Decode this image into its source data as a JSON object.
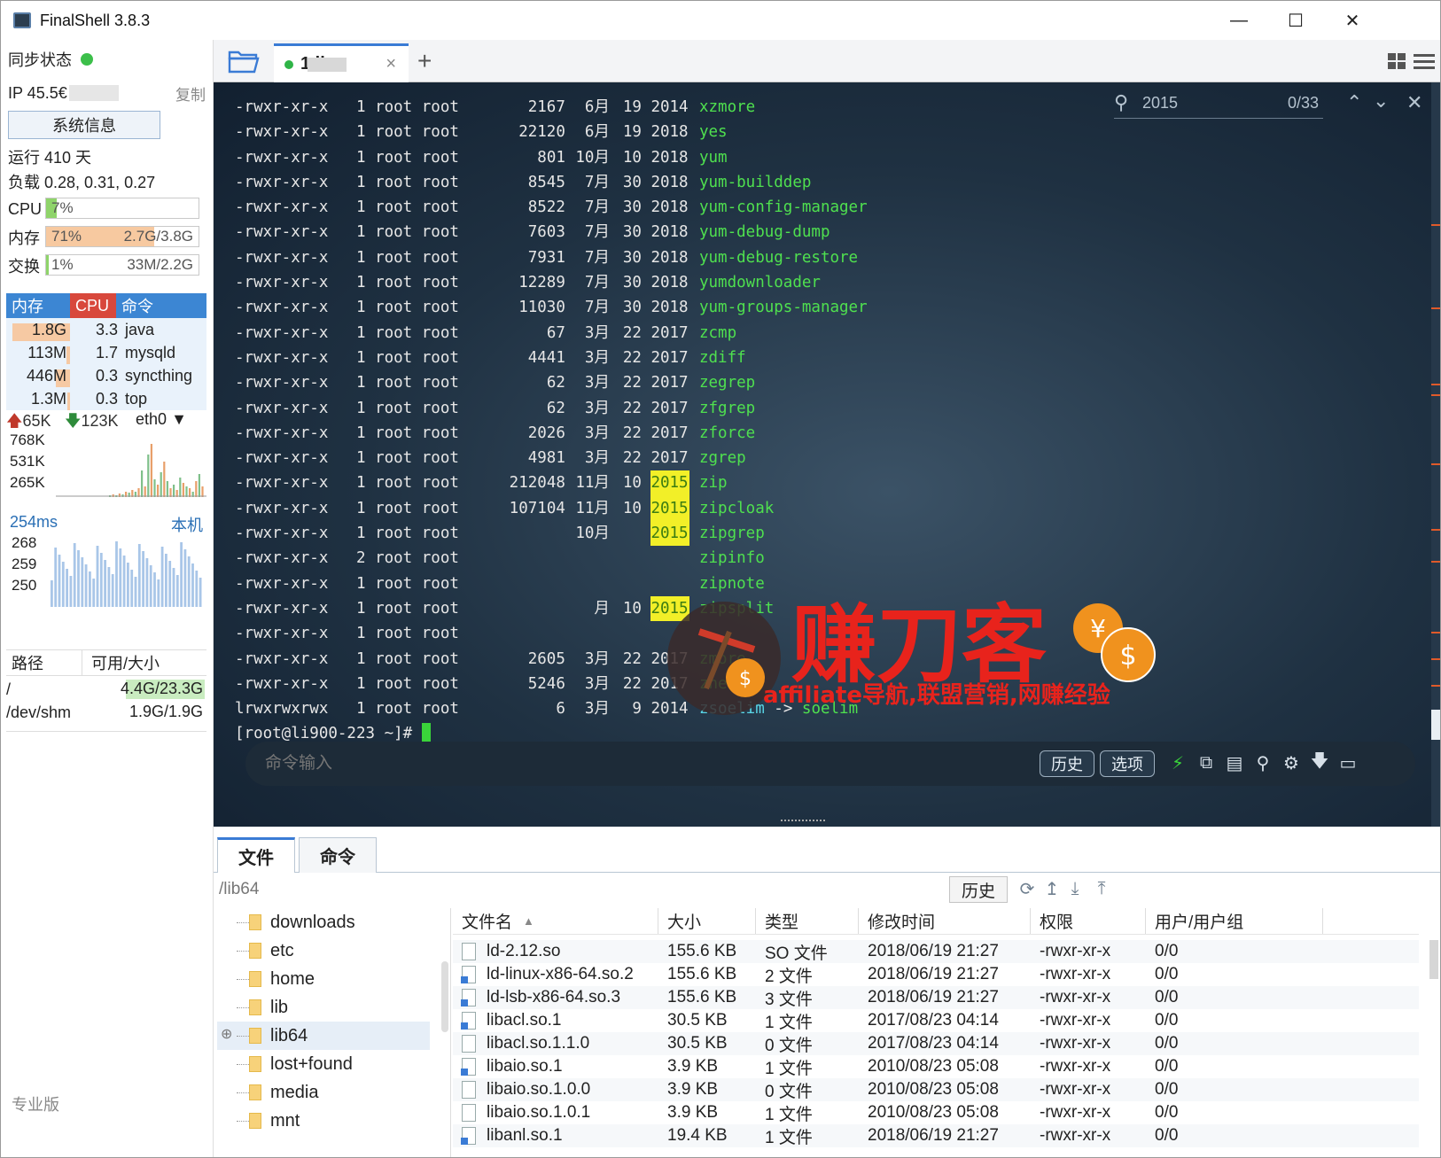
{
  "window": {
    "title": "FinalShell 3.8.3",
    "minimize": "—",
    "maximize": "☐",
    "close": "✕"
  },
  "sidebar": {
    "sync_label": "同步状态",
    "ip_label": "IP 45.5€",
    "copy": "复制",
    "sysinfo_button": "系统信息",
    "uptime": "运行 410 天",
    "load": "负载 0.28, 0.31, 0.27",
    "cpu": {
      "label": "CPU",
      "percent": "7%",
      "level": 0.07
    },
    "mem": {
      "label": "内存",
      "percent": "71%",
      "detail": "2.7G/3.8G",
      "level": 0.71
    },
    "swap": {
      "label": "交换",
      "percent": "1%",
      "detail": "33M/2.2G",
      "level": 0.01
    },
    "proc_headers": [
      "内存",
      "CPU",
      "命令"
    ],
    "processes": [
      {
        "mem": "1.8G",
        "cpu": "3.3",
        "cmd": "java",
        "mem_level": 0.9
      },
      {
        "mem": "113M",
        "cpu": "1.7",
        "cmd": "mysqld",
        "mem_level": 0.06
      },
      {
        "mem": "446M",
        "cpu": "0.3",
        "cmd": "syncthing",
        "mem_level": 0.22
      },
      {
        "mem": "1.3M",
        "cpu": "0.3",
        "cmd": "top",
        "mem_level": 0.01
      }
    ],
    "net": {
      "up": "65K",
      "down": "123K",
      "iface": "eth0",
      "y1": "768K",
      "y2": "531K",
      "y3": "265K"
    },
    "ping": {
      "latency": "254ms",
      "target": "本机",
      "y1": "268",
      "y2": "259",
      "y3": "250"
    },
    "disk_headers": [
      "路径",
      "可用/大小"
    ],
    "disks": [
      {
        "path": "/",
        "size": "4.4G/23.3G",
        "level": 0.81
      },
      {
        "path": "/dev/shm",
        "size": "1.9G/1.9G",
        "level": 0
      }
    ],
    "edition": "专业版"
  },
  "tabs": {
    "session_label": "1 li",
    "close": "×",
    "add": "+"
  },
  "terminal": {
    "search": {
      "query": "2015",
      "count": "0/33"
    },
    "lines": [
      {
        "perm": "-rwxr-xr-x",
        "n": "1",
        "size": "2167",
        "mon": "6月",
        "day": "19",
        "year": "2014",
        "name": "xzmore"
      },
      {
        "perm": "-rwxr-xr-x",
        "n": "1",
        "size": "22120",
        "mon": "6月",
        "day": "19",
        "year": "2018",
        "name": "yes"
      },
      {
        "perm": "-rwxr-xr-x",
        "n": "1",
        "size": "801",
        "mon": "10月",
        "day": "10",
        "year": "2018",
        "name": "yum"
      },
      {
        "perm": "-rwxr-xr-x",
        "n": "1",
        "size": "8545",
        "mon": "7月",
        "day": "30",
        "year": "2018",
        "name": "yum-builddep"
      },
      {
        "perm": "-rwxr-xr-x",
        "n": "1",
        "size": "8522",
        "mon": "7月",
        "day": "30",
        "year": "2018",
        "name": "yum-config-manager"
      },
      {
        "perm": "-rwxr-xr-x",
        "n": "1",
        "size": "7603",
        "mon": "7月",
        "day": "30",
        "year": "2018",
        "name": "yum-debug-dump"
      },
      {
        "perm": "-rwxr-xr-x",
        "n": "1",
        "size": "7931",
        "mon": "7月",
        "day": "30",
        "year": "2018",
        "name": "yum-debug-restore"
      },
      {
        "perm": "-rwxr-xr-x",
        "n": "1",
        "size": "12289",
        "mon": "7月",
        "day": "30",
        "year": "2018",
        "name": "yumdownloader"
      },
      {
        "perm": "-rwxr-xr-x",
        "n": "1",
        "size": "11030",
        "mon": "7月",
        "day": "30",
        "year": "2018",
        "name": "yum-groups-manager"
      },
      {
        "perm": "-rwxr-xr-x",
        "n": "1",
        "size": "67",
        "mon": "3月",
        "day": "22",
        "year": "2017",
        "name": "zcmp"
      },
      {
        "perm": "-rwxr-xr-x",
        "n": "1",
        "size": "4441",
        "mon": "3月",
        "day": "22",
        "year": "2017",
        "name": "zdiff"
      },
      {
        "perm": "-rwxr-xr-x",
        "n": "1",
        "size": "62",
        "mon": "3月",
        "day": "22",
        "year": "2017",
        "name": "zegrep"
      },
      {
        "perm": "-rwxr-xr-x",
        "n": "1",
        "size": "62",
        "mon": "3月",
        "day": "22",
        "year": "2017",
        "name": "zfgrep"
      },
      {
        "perm": "-rwxr-xr-x",
        "n": "1",
        "size": "2026",
        "mon": "3月",
        "day": "22",
        "year": "2017",
        "name": "zforce"
      },
      {
        "perm": "-rwxr-xr-x",
        "n": "1",
        "size": "4981",
        "mon": "3月",
        "day": "22",
        "year": "2017",
        "name": "zgrep"
      },
      {
        "perm": "-rwxr-xr-x",
        "n": "1",
        "size": "212048",
        "mon": "11月",
        "day": "10",
        "year": "2015",
        "name": "zip",
        "hl": true
      },
      {
        "perm": "-rwxr-xr-x",
        "n": "1",
        "size": "107104",
        "mon": "11月",
        "day": "10",
        "year": "2015",
        "name": "zipcloak",
        "hl": true
      },
      {
        "perm": "-rwxr-xr-x",
        "n": "1",
        "size": "",
        "mon": "10月",
        "day": "",
        "year": "2015",
        "name": "zipgrep",
        "hl": true
      },
      {
        "perm": "-rwxr-xr-x",
        "n": "2",
        "size": "",
        "mon": "",
        "day": "",
        "year": "",
        "name": "zipinfo"
      },
      {
        "perm": "-rwxr-xr-x",
        "n": "1",
        "size": "",
        "mon": "",
        "day": "",
        "year": "",
        "name": "zipnote"
      },
      {
        "perm": "-rwxr-xr-x",
        "n": "1",
        "size": "",
        "mon": "月",
        "day": "10",
        "year": "2015",
        "name": "zipsplit",
        "hl": true
      },
      {
        "perm": "-rwxr-xr-x",
        "n": "1",
        "size": "",
        "mon": "",
        "day": "",
        "year": "",
        "name": ""
      },
      {
        "perm": "-rwxr-xr-x",
        "n": "1",
        "size": "2605",
        "mon": "3月",
        "day": "22",
        "year": "2017",
        "name": "zmore"
      },
      {
        "perm": "-rwxr-xr-x",
        "n": "1",
        "size": "5246",
        "mon": "3月",
        "day": "22",
        "year": "2017",
        "name": "znew"
      },
      {
        "perm": "lrwxrwxrwx",
        "n": "1",
        "size": "6",
        "mon": "3月",
        "day": "9",
        "year": "2014",
        "name": "zsoelim",
        "link": "soelim"
      }
    ],
    "owner": "root root",
    "prompt": "[root@li900-223 ~]# ",
    "cmd_placeholder": "命令输入",
    "history_button": "历史",
    "options_button": "选项"
  },
  "watermark": {
    "title": "赚刀客",
    "subtitle": "affiliate导航,联盟营销,网赚经验"
  },
  "bottom": {
    "tabs": [
      "文件",
      "命令"
    ],
    "path": "/lib64",
    "history_button": "历史",
    "tree": [
      "downloads",
      "etc",
      "home",
      "lib",
      "lib64",
      "lost+found",
      "media",
      "mnt"
    ],
    "file_headers": [
      "文件名",
      "大小",
      "类型",
      "修改时间",
      "权限",
      "用户/用户组"
    ],
    "files": [
      {
        "name": "ld-2.12.so",
        "size": "155.6 KB",
        "type": "SO 文件",
        "mtime": "2018/06/19 21:27",
        "perm": "-rwxr-xr-x",
        "owner": "0/0",
        "link": false
      },
      {
        "name": "ld-linux-x86-64.so.2",
        "size": "155.6 KB",
        "type": "2 文件",
        "mtime": "2018/06/19 21:27",
        "perm": "-rwxr-xr-x",
        "owner": "0/0",
        "link": true
      },
      {
        "name": "ld-lsb-x86-64.so.3",
        "size": "155.6 KB",
        "type": "3 文件",
        "mtime": "2018/06/19 21:27",
        "perm": "-rwxr-xr-x",
        "owner": "0/0",
        "link": true
      },
      {
        "name": "libacl.so.1",
        "size": "30.5 KB",
        "type": "1 文件",
        "mtime": "2017/08/23 04:14",
        "perm": "-rwxr-xr-x",
        "owner": "0/0",
        "link": true
      },
      {
        "name": "libacl.so.1.1.0",
        "size": "30.5 KB",
        "type": "0 文件",
        "mtime": "2017/08/23 04:14",
        "perm": "-rwxr-xr-x",
        "owner": "0/0",
        "link": false
      },
      {
        "name": "libaio.so.1",
        "size": "3.9 KB",
        "type": "1 文件",
        "mtime": "2010/08/23 05:08",
        "perm": "-rwxr-xr-x",
        "owner": "0/0",
        "link": true
      },
      {
        "name": "libaio.so.1.0.0",
        "size": "3.9 KB",
        "type": "0 文件",
        "mtime": "2010/08/23 05:08",
        "perm": "-rwxr-xr-x",
        "owner": "0/0",
        "link": false
      },
      {
        "name": "libaio.so.1.0.1",
        "size": "3.9 KB",
        "type": "1 文件",
        "mtime": "2010/08/23 05:08",
        "perm": "-rwxr-xr-x",
        "owner": "0/0",
        "link": false
      },
      {
        "name": "libanl.so.1",
        "size": "19.4 KB",
        "type": "1 文件",
        "mtime": "2018/06/19 21:27",
        "perm": "-rwxr-xr-x",
        "owner": "0/0",
        "link": true
      }
    ]
  }
}
